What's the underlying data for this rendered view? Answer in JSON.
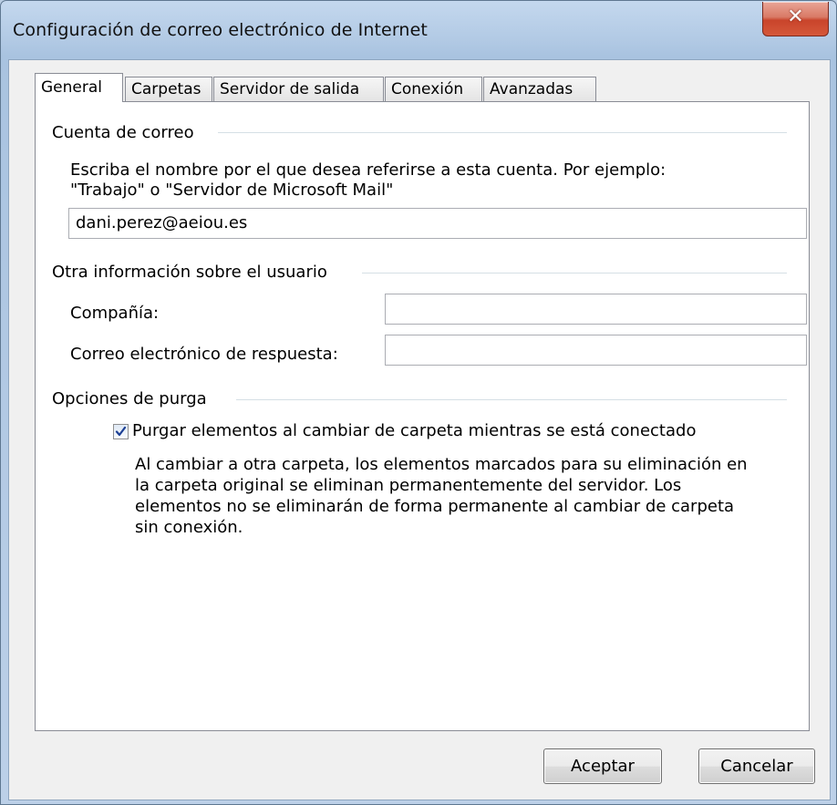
{
  "window": {
    "title": "Configuración de correo electrónico de Internet"
  },
  "tabs": [
    {
      "label": "General",
      "active": true
    },
    {
      "label": "Carpetas",
      "active": false
    },
    {
      "label": "Servidor de salida",
      "active": false
    },
    {
      "label": "Conexión",
      "active": false
    },
    {
      "label": "Avanzadas",
      "active": false
    }
  ],
  "cuenta": {
    "heading": "Cuenta de correo",
    "description_line1": "Escriba el nombre por el que desea referirse a esta cuenta. Por ejemplo:",
    "description_line2": "\"Trabajo\" o \"Servidor de Microsoft Mail\"",
    "name_value": "dani.perez@aeiou.es"
  },
  "usuario": {
    "heading": "Otra información sobre el usuario",
    "company_label": "Compañía:",
    "company_value": "",
    "reply_label": "Correo electrónico de respuesta:",
    "reply_value": ""
  },
  "purga": {
    "heading": "Opciones de purga",
    "checkbox_label": "Purgar elementos al cambiar de carpeta mientras se está conectado",
    "checked": true,
    "desc_line1": "Al cambiar a otra carpeta, los elementos marcados para su eliminación en",
    "desc_line2": "la carpeta original se eliminan permanentemente del servidor. Los",
    "desc_line3": "elementos no se eliminarán de forma permanente al cambiar de carpeta",
    "desc_line4": "sin conexión."
  },
  "buttons": {
    "ok": "Aceptar",
    "cancel": "Cancelar"
  },
  "colors": {
    "close_button": "#c9442b",
    "titlebar": "#b1c9e4",
    "dialog_bg": "#f0f0f0"
  }
}
